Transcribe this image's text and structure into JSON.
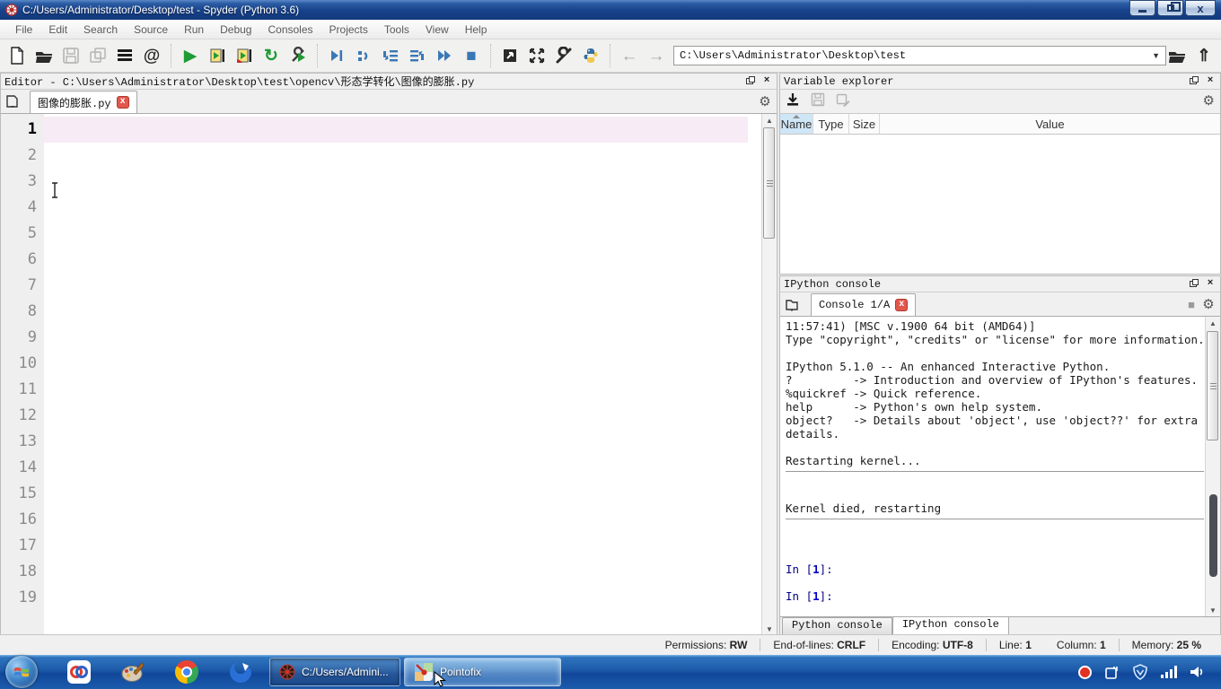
{
  "window": {
    "title": "C:/Users/Administrator/Desktop/test - Spyder (Python 3.6)"
  },
  "menu": {
    "items": [
      "File",
      "Edit",
      "Search",
      "Source",
      "Run",
      "Debug",
      "Consoles",
      "Projects",
      "Tools",
      "View",
      "Help"
    ]
  },
  "toolbar": {
    "address": "C:\\Users\\Administrator\\Desktop\\test",
    "symbol_finder_label": "@"
  },
  "editor": {
    "pane_title": "Editor - C:\\Users\\Administrator\\Desktop\\test\\opencv\\形态学转化\\图像的膨胀.py",
    "tab": "图像的膨胀.py",
    "tab_close": "x",
    "line_numbers": [
      "1",
      "2",
      "3",
      "4",
      "5",
      "6",
      "7",
      "8",
      "9",
      "10",
      "11",
      "12",
      "13",
      "14",
      "15",
      "16",
      "17",
      "18",
      "19"
    ]
  },
  "variable_explorer": {
    "pane_title": "Variable explorer",
    "columns": [
      "Name",
      "Type",
      "Size",
      "Value"
    ]
  },
  "ipython": {
    "pane_title": "IPython console",
    "tab": "Console 1/A",
    "tab_close": "x",
    "lines": [
      {
        "k": "out",
        "t": "11:57:41) [MSC v.1900 64 bit (AMD64)]"
      },
      {
        "k": "out",
        "t": "Type \"copyright\", \"credits\" or \"license\" for more information."
      },
      {
        "k": "out",
        "t": ""
      },
      {
        "k": "out",
        "t": "IPython 5.1.0 -- An enhanced Interactive Python."
      },
      {
        "k": "out",
        "t": "?         -> Introduction and overview of IPython's features."
      },
      {
        "k": "out",
        "t": "%quickref -> Quick reference."
      },
      {
        "k": "out",
        "t": "help      -> Python's own help system."
      },
      {
        "k": "out",
        "t": "object?   -> Details about 'object', use 'object??' for extra"
      },
      {
        "k": "out",
        "t": "details."
      },
      {
        "k": "out",
        "t": ""
      },
      {
        "k": "out",
        "t": "Restarting kernel..."
      },
      {
        "k": "rule",
        "t": ""
      },
      {
        "k": "out",
        "t": ""
      },
      {
        "k": "out",
        "t": ""
      },
      {
        "k": "out",
        "t": "Kernel died, restarting"
      },
      {
        "k": "rule",
        "t": ""
      },
      {
        "k": "out",
        "t": ""
      },
      {
        "k": "out",
        "t": ""
      },
      {
        "k": "out",
        "t": ""
      },
      {
        "k": "prompt",
        "t": "In [1]:"
      },
      {
        "k": "out",
        "t": ""
      },
      {
        "k": "prompt",
        "t": "In [1]:"
      }
    ],
    "bottom_tabs": [
      "Python console",
      "IPython console"
    ],
    "active_bottom_tab": "IPython console"
  },
  "status_bar": {
    "items": [
      {
        "label": "Permissions:",
        "value": "RW"
      },
      {
        "label": "End-of-lines:",
        "value": "CRLF"
      },
      {
        "label": "Encoding:",
        "value": "UTF-8"
      },
      {
        "label": "Line:",
        "value": "1"
      },
      {
        "label": "Column:",
        "value": "1"
      },
      {
        "label": "Memory:",
        "value": "25 %"
      }
    ]
  },
  "taskbar": {
    "buttons": [
      {
        "label": "C:/Users/Admini...",
        "icon": "spyder-icon"
      },
      {
        "label": "Pointofix",
        "icon": "pointofix-icon"
      }
    ]
  },
  "colors": {
    "titlebar_blue": "#17418a",
    "taskbar_blue": "#1c5aa8",
    "current_line_highlight": "#f7ebf6",
    "tab_close_red": "#e2574c",
    "run_green": "#1f9b35",
    "debug_blue": "#3a78b5",
    "prompt_navy": "#000080",
    "prompt_number_blue": "#0000cd",
    "name_header_blue": "#cfe6f7"
  }
}
